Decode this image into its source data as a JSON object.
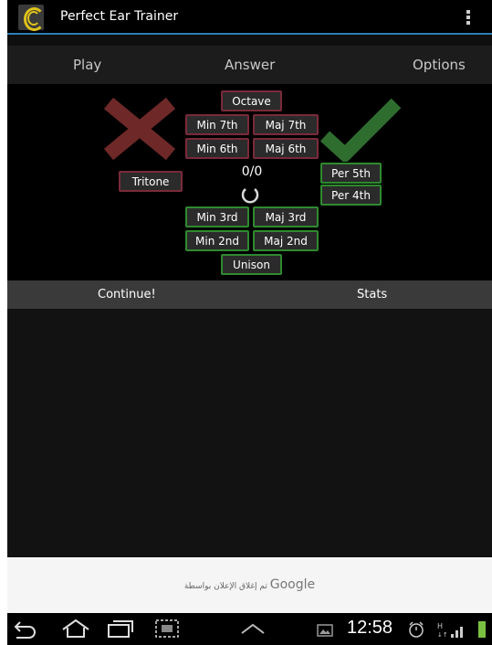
{
  "app": {
    "title": "Perfect Ear Trainer"
  },
  "tabs": [
    {
      "label": "Play"
    },
    {
      "label": "Answer"
    },
    {
      "label": "Options"
    }
  ],
  "quiz": {
    "score": "0/0",
    "intervals": {
      "octave": "Octave",
      "min7": "Min 7th",
      "maj7": "Maj 7th",
      "min6": "Min 6th",
      "maj6": "Maj 6th",
      "tritone": "Tritone",
      "per5": "Per 5th",
      "per4": "Per 4th",
      "min3": "Min 3rd",
      "maj3": "Maj 3rd",
      "min2": "Min 2nd",
      "maj2": "Maj 2nd",
      "unison": "Unison"
    }
  },
  "bottom": {
    "continue_label": "Continue!",
    "stats_label": "Stats"
  },
  "ad": {
    "google": "Google",
    "text": "تم إغلاق الإعلان بواسطة"
  },
  "status": {
    "time": "12:58"
  },
  "colors": {
    "accent": "#2a7fb8",
    "wrong": "#7a2a3a",
    "right": "#2f8a2f"
  },
  "icons": [
    "back-icon",
    "home-icon",
    "recent-apps-icon",
    "screenshot-icon",
    "chevron-up-icon",
    "image-icon",
    "alarm-icon",
    "signal-icon",
    "battery-icon"
  ]
}
